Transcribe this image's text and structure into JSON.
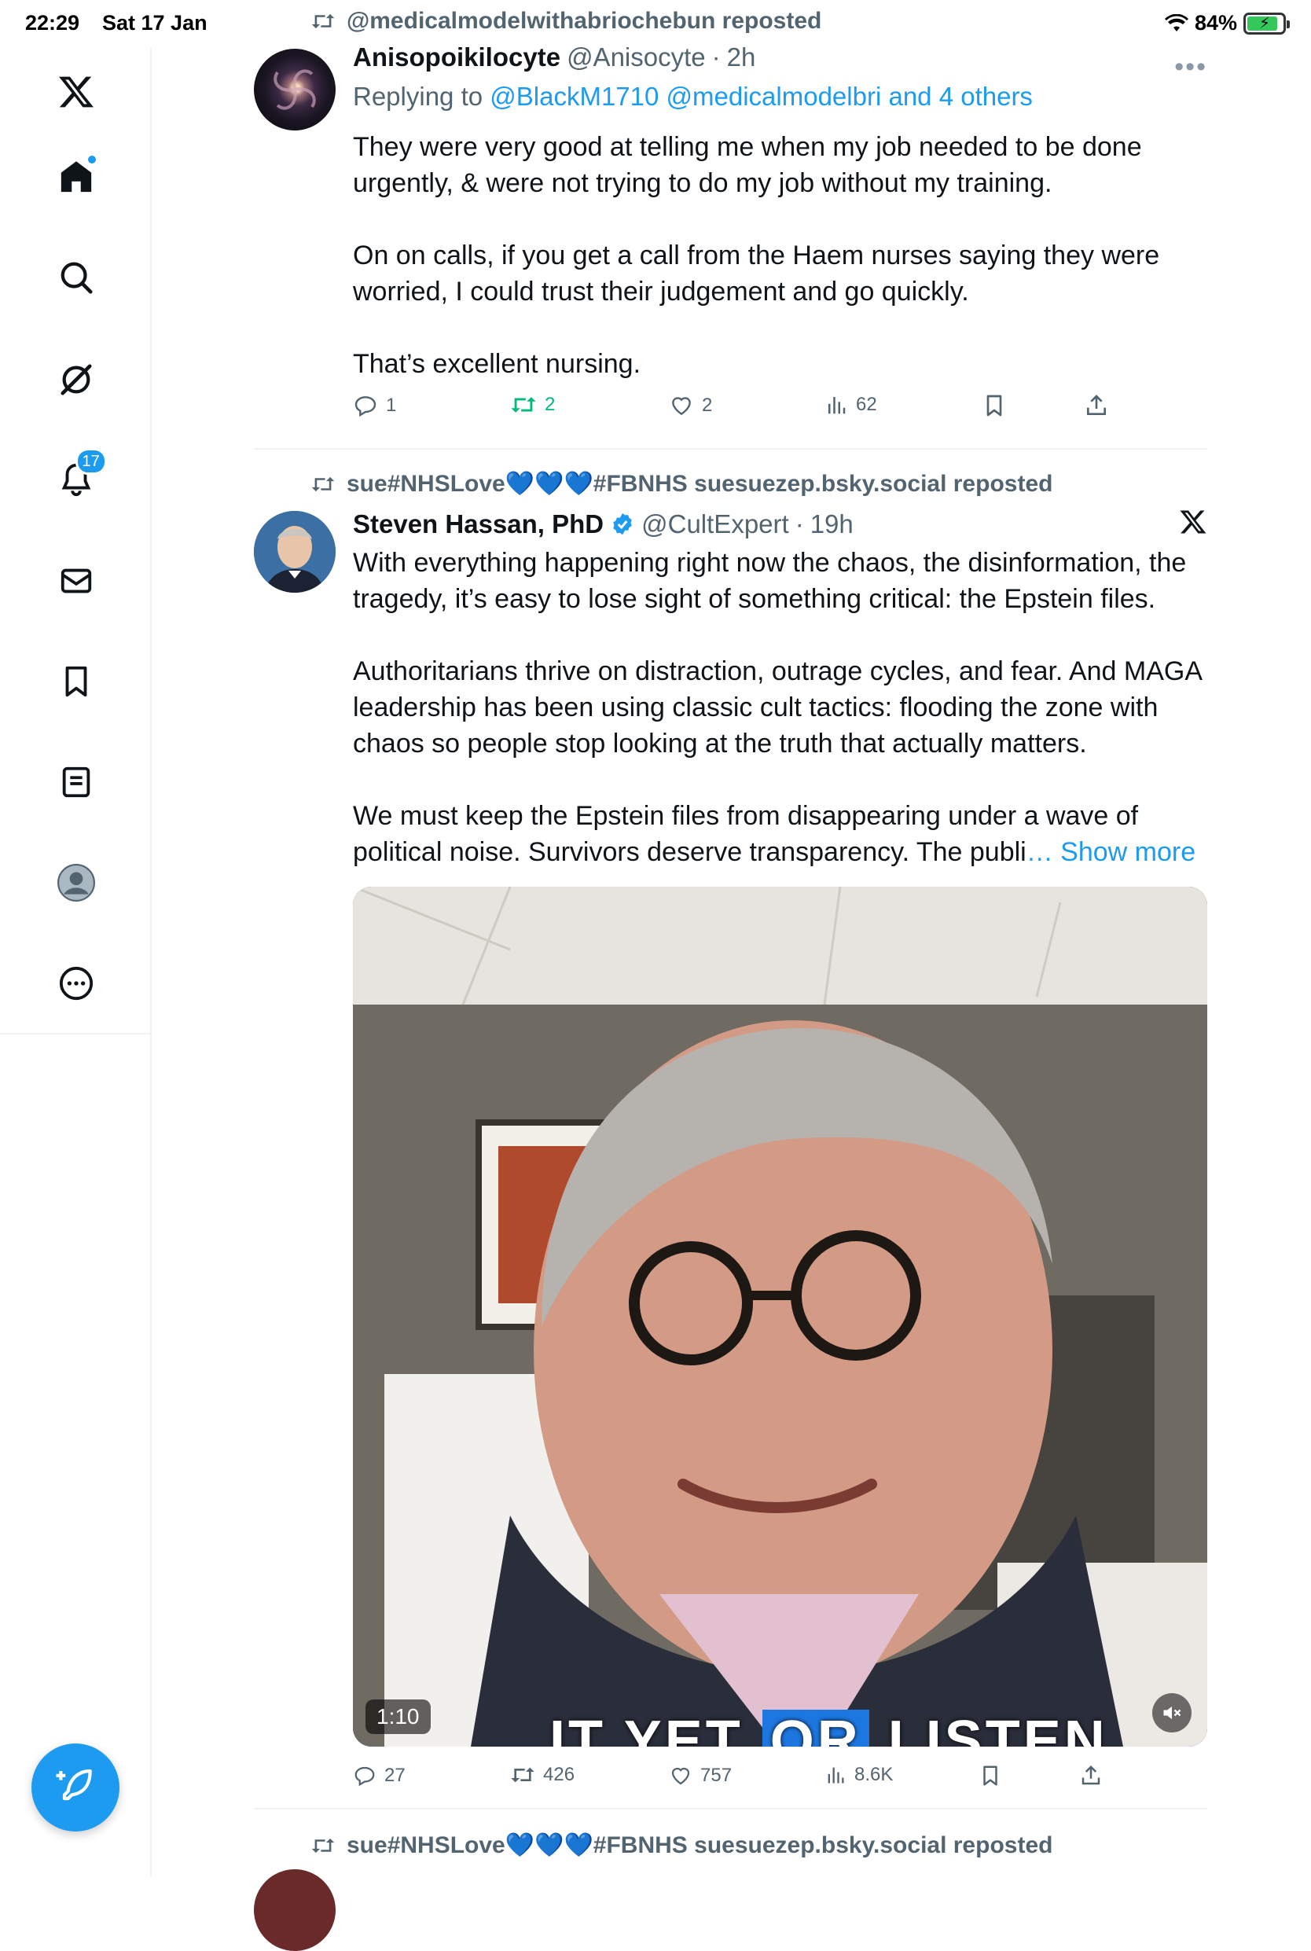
{
  "status_bar": {
    "time": "22:29",
    "date": "Sat 17 Jan",
    "battery": "84%"
  },
  "sidebar": {
    "notifications_badge": "17"
  },
  "tweets": [
    {
      "reposted_by": "@medicalmodelwithabriochebun reposted",
      "name": "Anisopoikilocyte",
      "handle": "@Anisocyte",
      "time": "2h",
      "replying_prefix": "Replying to ",
      "replying_to": "@BlackM1710 @medicalmodelbri and 4 others",
      "text": "They were very good at telling me when my job needed to be done urgently, & were not trying to do my job without my training.\n\nOn on calls, if you get a call from the Haem nurses saying they were worried, I could trust their judgement and go quickly.\n\nThat’s excellent nursing.",
      "replies": "1",
      "reposts": "2",
      "likes": "2",
      "views": "62"
    },
    {
      "reposted_by": "sue#NHSLove💙💙💙#FBNHS suesuezep.bsky.social reposted",
      "name": "Steven Hassan, PhD",
      "handle": "@CultExpert",
      "time": "19h",
      "text": "With everything happening right now the chaos, the disinformation, the tragedy, it’s easy to lose sight of something critical: the Epstein files.\n\nAuthoritarians thrive on distraction, outrage cycles, and fear. And MAGA leadership has been using classic cult tactics: flooding the zone with chaos so people stop looking at the truth that actually matters.\n\nWe must keep the Epstein files from disappearing under a wave of political noise. Survivors deserve transparency. The publi",
      "show_more": "… Show more",
      "video_duration": "1:10",
      "video_caption_a": "IT YET ",
      "video_caption_b": "OR",
      "video_caption_c": " LISTEN",
      "replies": "27",
      "reposts": "426",
      "likes": "757",
      "views": "8.6K"
    },
    {
      "reposted_by": "sue#NHSLove💙💙💙#FBNHS suesuezep.bsky.social reposted"
    }
  ],
  "colors": {
    "accent": "#1d9bf0",
    "repost_green": "#00ba7c",
    "muted": "#536471"
  }
}
